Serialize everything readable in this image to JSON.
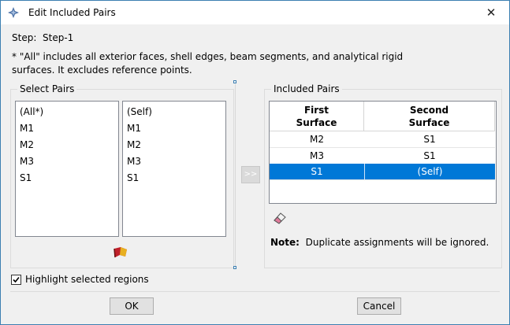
{
  "window": {
    "title": "Edit Included Pairs",
    "close_glyph": "✕"
  },
  "step": {
    "label": "Step:",
    "value": "Step-1"
  },
  "info_note": "* \"All\" includes all exterior faces, shell edges, beam segments, and analytical rigid surfaces. It excludes reference points.",
  "select_pairs": {
    "title": "Select Pairs",
    "first_list": [
      "(All*)",
      "M1",
      "M2",
      "M3",
      "S1"
    ],
    "second_list": [
      "(Self)",
      "M1",
      "M2",
      "M3",
      "S1"
    ]
  },
  "add_button_label": ">>",
  "included_pairs": {
    "title": "Included Pairs",
    "columns": [
      "First\nSurface",
      "Second\nSurface"
    ],
    "rows": [
      {
        "first": "M2",
        "second": "S1",
        "selected": false
      },
      {
        "first": "M3",
        "second": "S1",
        "selected": false
      },
      {
        "first": "S1",
        "second": "(Self)",
        "selected": true
      }
    ]
  },
  "note": {
    "label": "Note:",
    "text": "Duplicate assignments will be ignored."
  },
  "highlight": {
    "label": "Highlight selected regions",
    "checked": true
  },
  "buttons": {
    "ok": "OK",
    "cancel": "Cancel"
  },
  "icons": {
    "app": "abaqus-icon",
    "eraser": "eraser-icon",
    "flag": "highlight-flag-icon"
  },
  "colors": {
    "selection": "#0078d7",
    "accent": "#3c7fb1"
  }
}
